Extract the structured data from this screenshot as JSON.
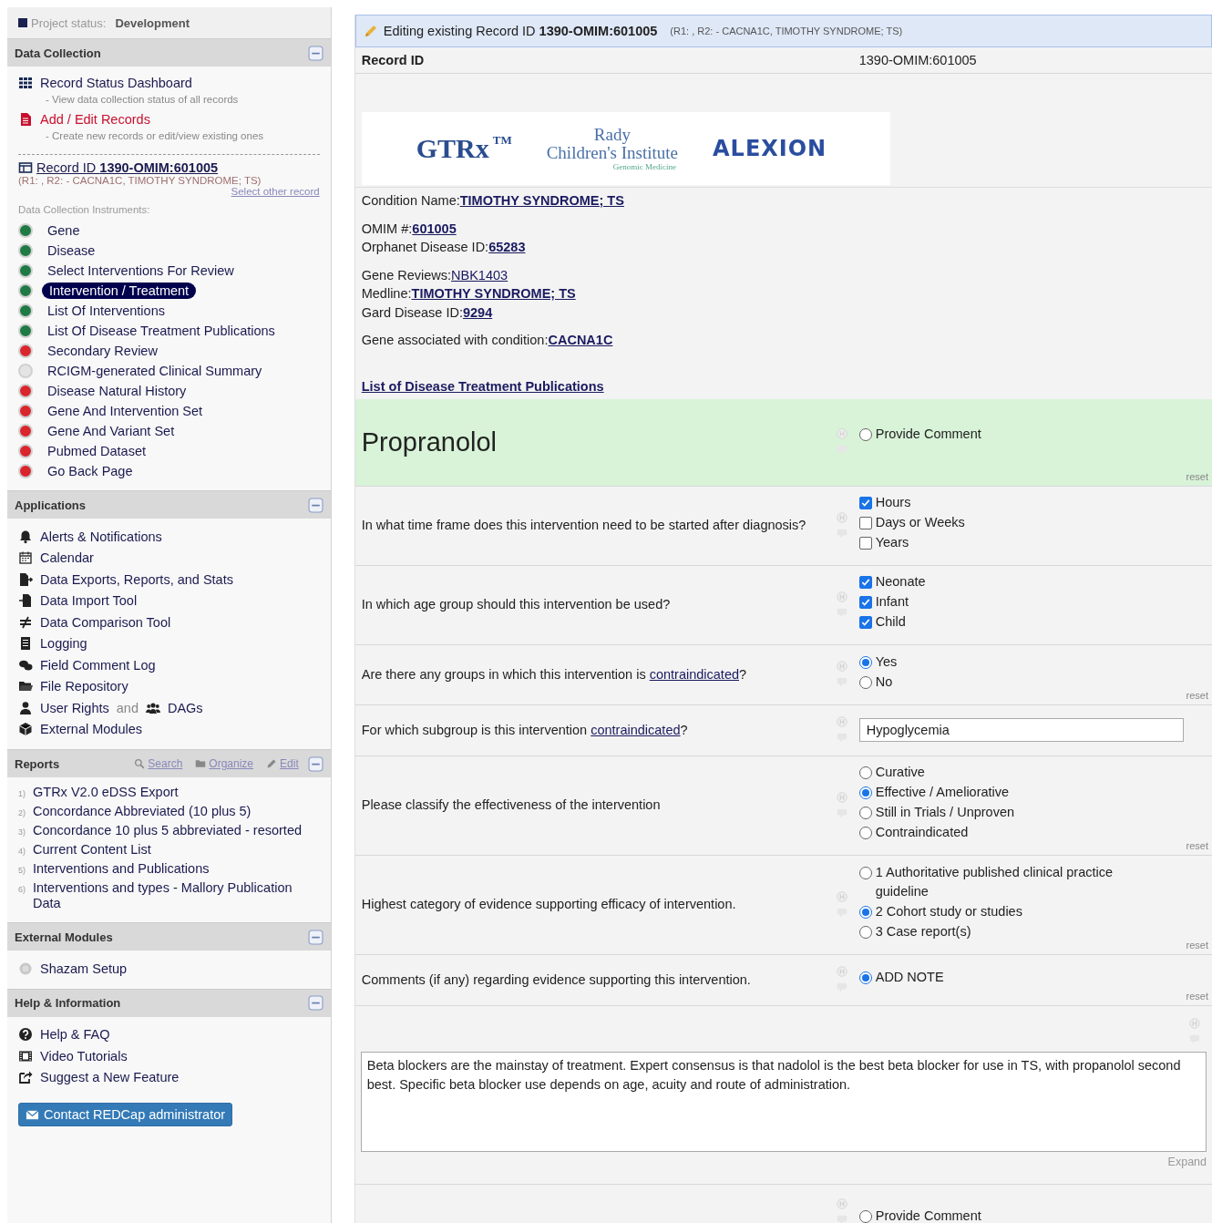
{
  "sidebar": {
    "project_status": {
      "label": "Project status:",
      "value": "Development"
    },
    "data_collection": {
      "title": "Data Collection",
      "links": [
        {
          "label": "Record Status Dashboard",
          "note": "- View data collection status of all records"
        },
        {
          "label": "Add / Edit Records",
          "note": "- Create new records or edit/view existing ones"
        }
      ],
      "record": {
        "text": "Record ID **1390-OMIM:601005**",
        "detail": "(R1: , R2: - CACNA1C, TIMOTHY SYNDROME; TS)",
        "select_link": "Select other record"
      },
      "instruments_label": "Data Collection Instruments:",
      "instruments": [
        {
          "label": "Gene",
          "color": "#1f7a44",
          "selected": false
        },
        {
          "label": "Disease",
          "color": "#1f7a44",
          "selected": false
        },
        {
          "label": "Select Interventions For Review",
          "color": "#1f7a44",
          "selected": false
        },
        {
          "label": "Intervention / Treatment",
          "color": "#1f7a44",
          "selected": true
        },
        {
          "label": "List Of Interventions",
          "color": "#1f7a44",
          "selected": false
        },
        {
          "label": "List Of Disease Treatment Publications",
          "color": "#1f7a44",
          "selected": false
        },
        {
          "label": "Secondary Review",
          "color": "#d9262c",
          "selected": false
        },
        {
          "label": "RCIGM-generated Clinical Summary",
          "color": "#e4e4e4",
          "selected": false
        },
        {
          "label": "Disease Natural History",
          "color": "#d9262c",
          "selected": false
        },
        {
          "label": "Gene And Intervention Set",
          "color": "#d9262c",
          "selected": false
        },
        {
          "label": "Gene And Variant Set",
          "color": "#d9262c",
          "selected": false
        },
        {
          "label": "Pubmed Dataset",
          "color": "#d9262c",
          "selected": false
        },
        {
          "label": "Go Back Page",
          "color": "#d9262c",
          "selected": false
        }
      ]
    },
    "applications": {
      "title": "Applications",
      "items": [
        {
          "label": "Alerts & Notifications"
        },
        {
          "label": "Calendar"
        },
        {
          "label": "Data Exports, Reports, and Stats"
        },
        {
          "label": "Data Import Tool"
        },
        {
          "label": "Data Comparison Tool"
        },
        {
          "label": "Logging"
        },
        {
          "label": "Field Comment Log"
        },
        {
          "label": "File Repository"
        },
        {
          "label": "User Rights",
          "joiner": "and",
          "extra": "DAGs"
        },
        {
          "label": "External Modules"
        }
      ]
    },
    "reports": {
      "title": "Reports",
      "tools": [
        "Search",
        "Organize",
        "Edit"
      ],
      "items": [
        {
          "number": "1)",
          "label": "GTRx V2.0 eDSS Export"
        },
        {
          "number": "2)",
          "label": "Concordance Abbreviated (10 plus 5)"
        },
        {
          "number": "3)",
          "label": "Concordance 10 plus 5 abbreviated - resorted"
        },
        {
          "number": "4)",
          "label": "Current Content List"
        },
        {
          "number": "5)",
          "label": "Interventions and Publications"
        },
        {
          "number": "6)",
          "label": "Interventions and types - Mallory Publication Data"
        }
      ]
    },
    "external_modules": {
      "title": "External Modules",
      "items": [
        "Shazam Setup"
      ]
    },
    "help": {
      "title": "Help & Information",
      "items": [
        "Help & FAQ",
        "Video Tutorials",
        "Suggest a New Feature"
      ],
      "contact_button": "Contact REDCap administrator"
    }
  },
  "form": {
    "banner": {
      "text": "Editing existing Record ID **1390-OMIM:601005**",
      "detail": "(R1: , R2: - CACNA1C, TIMOTHY SYNDROME; TS)"
    },
    "record_id": {
      "label": "Record ID",
      "value": "1390-OMIM:601005"
    },
    "logos": {
      "gtrx": "GTRx",
      "gtrx_mark": "TM",
      "rady_top": "Rady",
      "rady_main": "Children's Institute",
      "rady_sub": "Genomic Medicine",
      "alexion": "ALEXION"
    },
    "info": [
      [
        {
          "label": "Condition Name:",
          "link": "TIMOTHY SYNDROME; TS",
          "bold": true
        }
      ],
      [
        {
          "label": "OMIM #:",
          "link": "601005",
          "bold": true
        },
        {
          "label": "Orphanet Disease ID:",
          "link": "65283",
          "bold": true
        }
      ],
      [
        {
          "label": "Gene Reviews:",
          "link": "NBK1403",
          "bold": false
        },
        {
          "label": "Medline:",
          "link": "TIMOTHY SYNDROME; TS",
          "bold": true
        },
        {
          "label": "Gard Disease ID:",
          "link": "9294",
          "bold": true
        }
      ],
      [
        {
          "label": "Gene associated with condition:",
          "link": "CACNA1C",
          "bold": true
        }
      ]
    ],
    "publications_link": "List of Disease Treatment Publications",
    "fields": [
      {
        "kind": "header",
        "title": "Propranolol",
        "options": [
          {
            "label": "Provide Comment",
            "selected": false
          }
        ],
        "reset": "reset"
      },
      {
        "kind": "checkbox",
        "question": "In what time frame does this intervention need to be started after diagnosis?",
        "options": [
          {
            "label": "Hours",
            "checked": true
          },
          {
            "label": "Days or Weeks",
            "checked": false
          },
          {
            "label": "Years",
            "checked": false
          }
        ]
      },
      {
        "kind": "checkbox",
        "question": "In which age group should this intervention be used?",
        "options": [
          {
            "label": "Neonate",
            "checked": true
          },
          {
            "label": "Infant",
            "checked": true
          },
          {
            "label": "Child",
            "checked": true
          }
        ]
      },
      {
        "kind": "radio",
        "question": "Are there any groups in which this intervention is ",
        "link": "contraindicated",
        "question_end": "?",
        "options": [
          {
            "label": "Yes",
            "selected": true
          },
          {
            "label": "No",
            "selected": false
          }
        ],
        "reset": "reset"
      },
      {
        "kind": "text",
        "question": "For which subgroup is this intervention ",
        "link": "contraindicated",
        "question_end": "?",
        "value": "Hypoglycemia"
      },
      {
        "kind": "radio",
        "question": "Please classify the effectiveness of the intervention",
        "options": [
          {
            "label": "Curative",
            "selected": false
          },
          {
            "label": "Effective / Ameliorative",
            "selected": true
          },
          {
            "label": "Still in Trials / Unproven",
            "selected": false
          },
          {
            "label": "Contraindicated",
            "selected": false
          }
        ],
        "reset": "reset"
      },
      {
        "kind": "radio",
        "question": "Highest category of evidence supporting efficacy of intervention.",
        "options": [
          {
            "label": "1 Authoritative published clinical practice guideline",
            "selected": false
          },
          {
            "label": "2 Cohort study or studies",
            "selected": true
          },
          {
            "label": "3 Case report(s)",
            "selected": false
          }
        ],
        "reset": "reset"
      },
      {
        "kind": "radio",
        "question": "Comments (if any) regarding evidence supporting this intervention.",
        "options": [
          {
            "label": "ADD NOTE",
            "selected": true
          }
        ],
        "reset": "reset"
      },
      {
        "kind": "textarea",
        "value": "Beta blockers are the mainstay of treatment. Expert consensus is that nadolol is the best beta blocker for use in TS, with propanolol second best. Specific beta blocker use depends on age, acuity and route of administration.",
        "expand": "Expand"
      },
      {
        "kind": "radio",
        "options": [
          {
            "label": "Provide Comment",
            "selected": false
          }
        ]
      }
    ]
  }
}
